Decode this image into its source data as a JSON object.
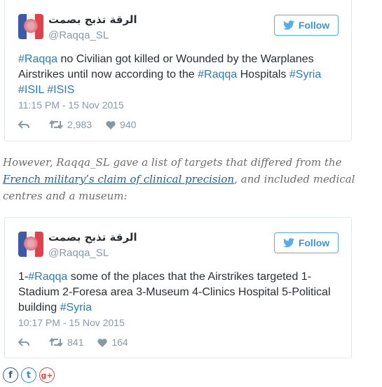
{
  "colors": {
    "accent": "#3b94d9",
    "hashtag": "#2b7bb9",
    "muted": "#8899a6",
    "link": "#2a5d8c"
  },
  "tweets": [
    {
      "name": "الرقة تذبح بصمت",
      "handle": "@Raqqa_SL",
      "follow_label": "Follow",
      "text_parts": [
        {
          "t": "#Raqqa",
          "ht": true
        },
        {
          "t": " no Civilian got killed or Wounded by the Warplanes Airstrikes until now according to the ",
          "ht": false
        },
        {
          "t": "#Raqqa",
          "ht": true
        },
        {
          "t": " Hospitals ",
          "ht": false
        },
        {
          "t": "#Syria",
          "ht": true
        },
        {
          "t": " ",
          "ht": false
        },
        {
          "t": "#ISIL",
          "ht": true
        },
        {
          "t": " ",
          "ht": false
        },
        {
          "t": "#ISIS",
          "ht": true
        }
      ],
      "time": "11:15 PM - 15 Nov 2015",
      "retweets": "2,983",
      "likes": "940"
    },
    {
      "name": "الرقة تذبح بصمت",
      "handle": "@Raqqa_SL",
      "follow_label": "Follow",
      "text_parts": [
        {
          "t": "1-",
          "ht": false
        },
        {
          "t": "#Raqqa",
          "ht": true
        },
        {
          "t": " some of the places that the Airstrikes targeted 1-Stadium 2-Foresa area 3-Museum 4-Clinics Hospital 5-Political building ",
          "ht": false
        },
        {
          "t": "#Syria",
          "ht": true
        }
      ],
      "time": "10:17 PM - 15 Nov 2015",
      "retweets": "841",
      "likes": "164"
    }
  ],
  "paragraph": {
    "before": "However, Raqqa_SL gave a list of targets that differed from the ",
    "link": "French military’s claim of clinical precision",
    "after": ", and included medical centres and a museum:"
  },
  "share": {
    "facebook": "f",
    "twitter": "t",
    "googleplus": "g+"
  }
}
